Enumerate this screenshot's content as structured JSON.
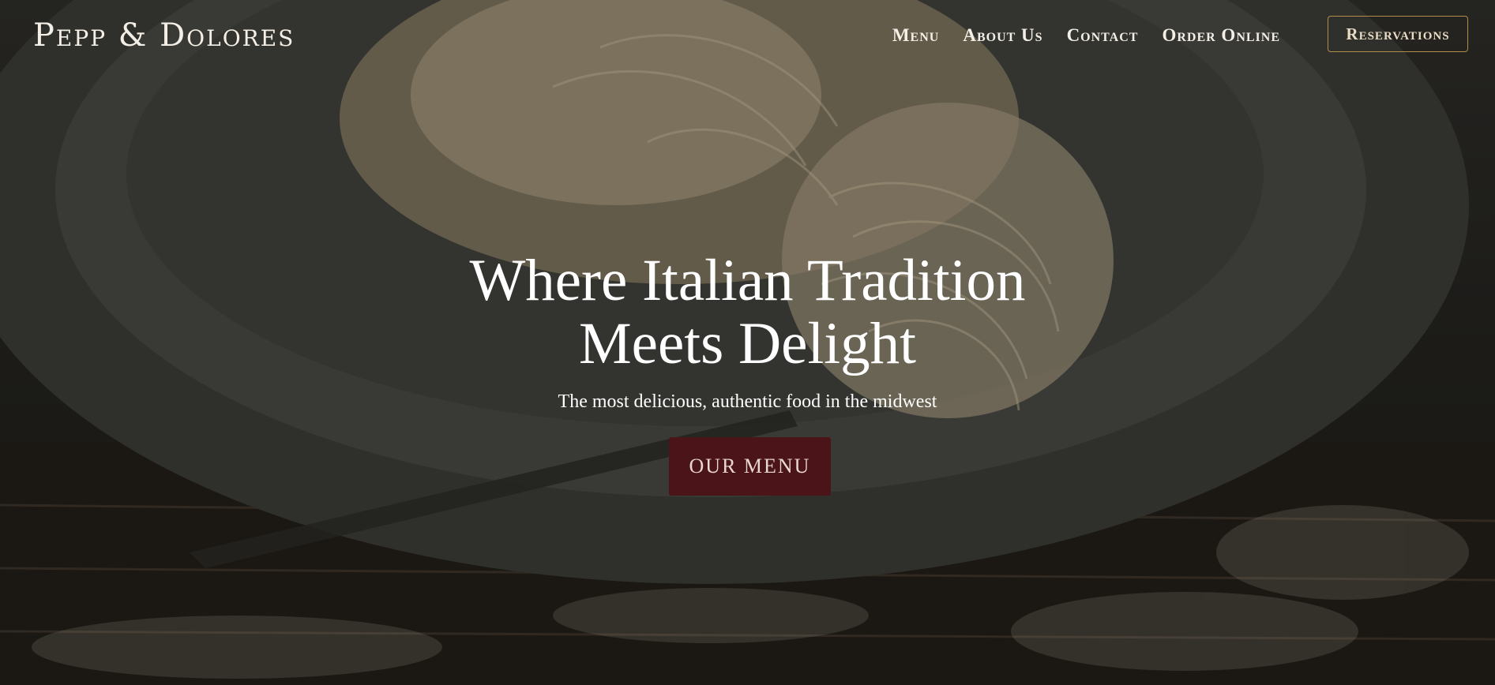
{
  "header": {
    "logo": "Pepp & Dolores",
    "nav": [
      {
        "label": "Menu"
      },
      {
        "label": "About Us"
      },
      {
        "label": "Contact"
      },
      {
        "label": "Order Online"
      }
    ],
    "reservations_label": "Reservations"
  },
  "hero": {
    "title_line1": "Where Italian Tradition",
    "title_line2": "Meets Delight",
    "subtitle": "The most delicious, authentic food in the midwest",
    "cta_label": "OUR MENU",
    "background_image": "pasta-plate-photo"
  },
  "colors": {
    "text": "#ffffff",
    "accent_border": "#b08e4a",
    "cta_background": "#4a1418"
  }
}
